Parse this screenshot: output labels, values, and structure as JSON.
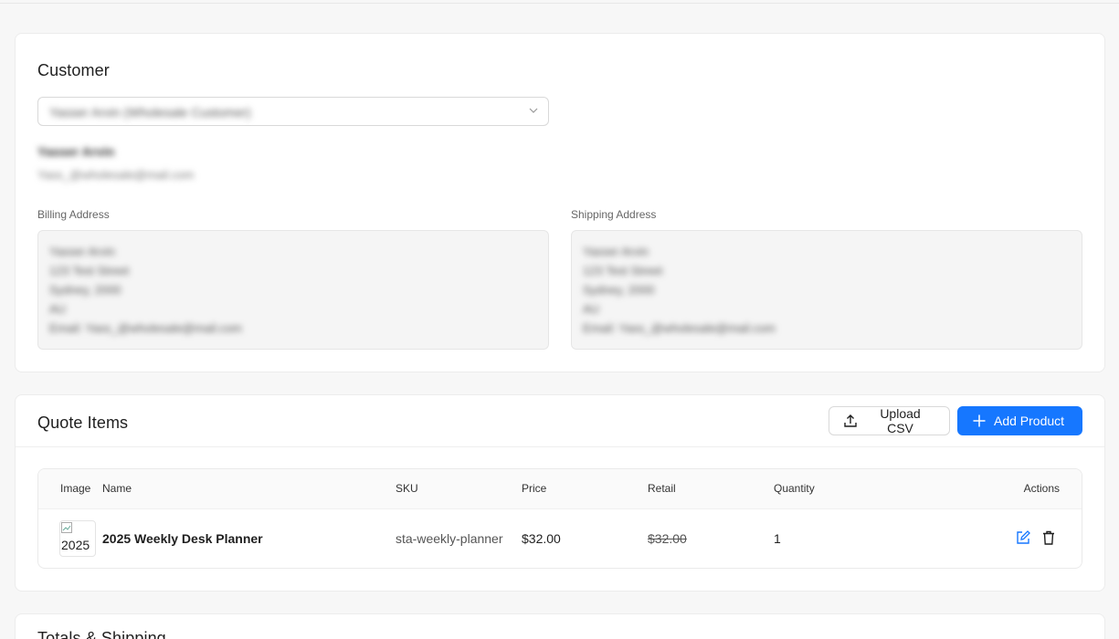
{
  "customer": {
    "title": "Customer",
    "select_value": "Yasser Arvin (Wholesale Customer)",
    "name": "Yasser Arvin",
    "email": "Yass_@wholesale@mail.com",
    "billing_label": "Billing Address",
    "shipping_label": "Shipping Address",
    "billing_lines": [
      "Yasser Arvin",
      "123 Test Street",
      "Sydney, 2000",
      "AU",
      "Email: Yass_@wholesale@mail.com"
    ],
    "shipping_lines": [
      "Yasser Arvin",
      "123 Test Street",
      "Sydney, 2000",
      "AU",
      "Email: Yass_@wholesale@mail.com"
    ]
  },
  "quote": {
    "title": "Quote Items",
    "upload_label": "Upload CSV",
    "add_label": "Add Product",
    "columns": {
      "image": "Image",
      "name": "Name",
      "sku": "SKU",
      "price": "Price",
      "retail": "Retail",
      "quantity": "Quantity",
      "actions": "Actions"
    },
    "items": [
      {
        "image_alt": "2025",
        "name": "2025 Weekly Desk Planner",
        "sku": "sta-weekly-planner",
        "price": "$32.00",
        "retail": "$32.00",
        "quantity": "1"
      }
    ]
  },
  "totals": {
    "title": "Totals & Shipping"
  },
  "colors": {
    "primary": "#1677ff",
    "background": "#f7f7f7",
    "card": "#ffffff"
  },
  "icons": [
    "chevron-down-icon",
    "upload-icon",
    "plus-icon",
    "broken-image-icon",
    "edit-icon",
    "trash-icon"
  ]
}
